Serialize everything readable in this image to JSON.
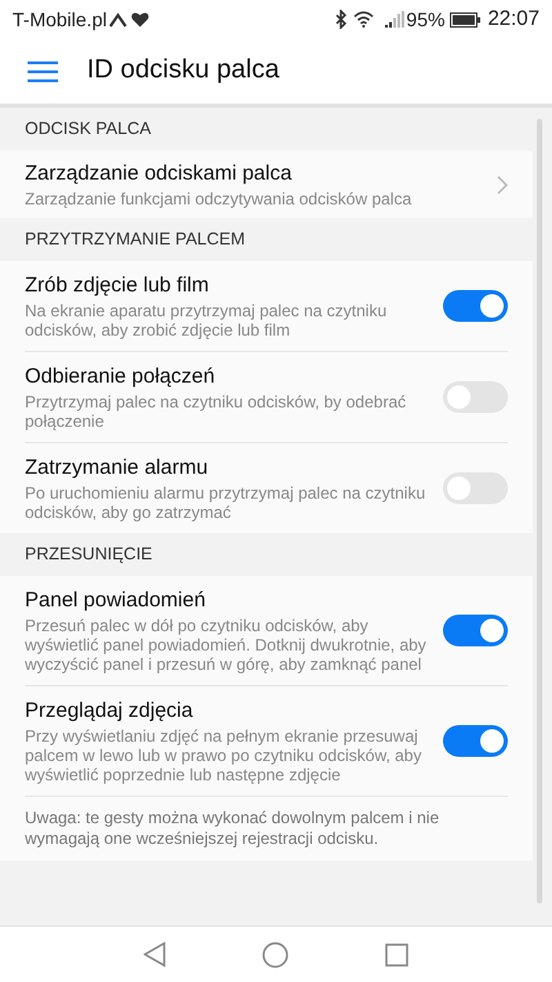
{
  "status_bar": {
    "carrier": "T-Mobile.pl",
    "battery": "95%",
    "time": "22:07"
  },
  "app_bar": {
    "title": "ID odcisku palca"
  },
  "sections": [
    {
      "header": "ODCISK PALCA",
      "items": [
        {
          "kind": "link",
          "title": "Zarządzanie odciskami palca",
          "subtitle": "Zarządzanie funkcjami odczytywania odcisków palca"
        }
      ]
    },
    {
      "header": "PRZYTRZYMANIE PALCEM",
      "items": [
        {
          "kind": "switch",
          "title": "Zrób zdjęcie lub film",
          "subtitle": "Na ekranie aparatu przytrzymaj palec na czytniku odcisków, aby zrobić zdjęcie lub film",
          "on": true
        },
        {
          "kind": "switch",
          "title": "Odbieranie połączeń",
          "subtitle": "Przytrzymaj palec na czytniku odcisków, by odebrać połączenie",
          "on": false
        },
        {
          "kind": "switch",
          "title": "Zatrzymanie alarmu",
          "subtitle": "Po uruchomieniu alarmu przytrzymaj palec na czytniku odcisków, aby go zatrzymać",
          "on": false
        }
      ]
    },
    {
      "header": "PRZESUNIĘCIE",
      "items": [
        {
          "kind": "switch",
          "title": "Panel powiadomień",
          "subtitle": "Przesuń palec w dół po czytniku odcisków, aby wyświetlić panel powiadomień. Dotknij dwukrotnie, aby wyczyścić panel i przesuń w górę, aby zamknąć panel",
          "on": true
        },
        {
          "kind": "switch",
          "title": "Przeglądaj zdjęcia",
          "subtitle": "Przy wyświetlaniu zdjęć na pełnym ekranie przesuwaj palcem w lewo lub w prawo po czytniku odcisków, aby wyświetlić poprzednie lub następne zdjęcie",
          "on": true
        },
        {
          "kind": "note",
          "text": "Uwaga: te gesty można wykonać dowolnym palcem i nie wymagają one wcześniejszej rejestracji odcisku."
        }
      ]
    }
  ]
}
